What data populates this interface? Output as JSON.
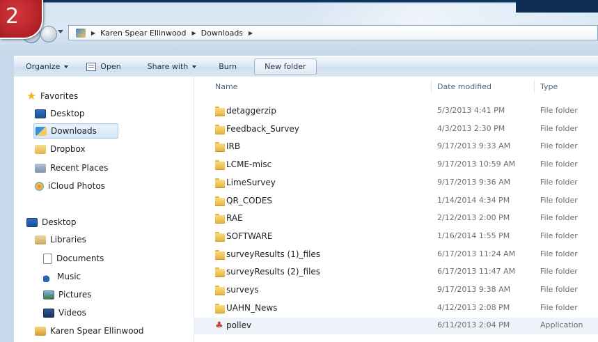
{
  "badge": "2",
  "address": {
    "crumbs": [
      "Karen Spear Ellinwood",
      "Downloads"
    ]
  },
  "toolbar": {
    "organize": "Organize",
    "open": "Open",
    "share_with": "Share with",
    "burn": "Burn",
    "new_folder": "New folder"
  },
  "nav": {
    "favorites": "Favorites",
    "desktop": "Desktop",
    "downloads": "Downloads",
    "dropbox": "Dropbox",
    "recent_places": "Recent Places",
    "icloud_photos": "iCloud Photos",
    "desktop_root": "Desktop",
    "libraries": "Libraries",
    "documents": "Documents",
    "music": "Music",
    "pictures": "Pictures",
    "videos": "Videos",
    "user": "Karen Spear Ellinwood"
  },
  "columns": {
    "name": "Name",
    "date_modified": "Date modified",
    "type": "Type"
  },
  "files": [
    {
      "name": "detaggerzip",
      "date": "5/3/2013 4:41 PM",
      "type": "File folder",
      "icon": "folder-icon"
    },
    {
      "name": "Feedback_Survey",
      "date": "4/3/2013 2:30 PM",
      "type": "File folder",
      "icon": "folder-icon"
    },
    {
      "name": "IRB",
      "date": "9/17/2013 9:33 AM",
      "type": "File folder",
      "icon": "folder-icon"
    },
    {
      "name": "LCME-misc",
      "date": "9/17/2013 10:59 AM",
      "type": "File folder",
      "icon": "folder-icon"
    },
    {
      "name": "LimeSurvey",
      "date": "9/17/2013 9:36 AM",
      "type": "File folder",
      "icon": "folder-icon"
    },
    {
      "name": "QR_CODES",
      "date": "1/14/2014 4:34 PM",
      "type": "File folder",
      "icon": "folder-icon"
    },
    {
      "name": "RAE",
      "date": "2/12/2013 2:00 PM",
      "type": "File folder",
      "icon": "folder-icon"
    },
    {
      "name": "SOFTWARE",
      "date": "1/16/2014 1:55 PM",
      "type": "File folder",
      "icon": "folder-icon"
    },
    {
      "name": "surveyResults (1)_files",
      "date": "6/17/2013 11:24 AM",
      "type": "File folder",
      "icon": "folder-icon"
    },
    {
      "name": "surveyResults (2)_files",
      "date": "6/17/2013 11:47 AM",
      "type": "File folder",
      "icon": "folder-icon"
    },
    {
      "name": "surveys",
      "date": "9/17/2013 9:38 AM",
      "type": "File folder",
      "icon": "folder-icon"
    },
    {
      "name": "UAHN_News",
      "date": "4/12/2013 2:08 PM",
      "type": "File folder",
      "icon": "folder-icon"
    },
    {
      "name": "pollev",
      "date": "6/11/2013 2:04 PM",
      "type": "Application",
      "icon": "application-icon"
    }
  ]
}
